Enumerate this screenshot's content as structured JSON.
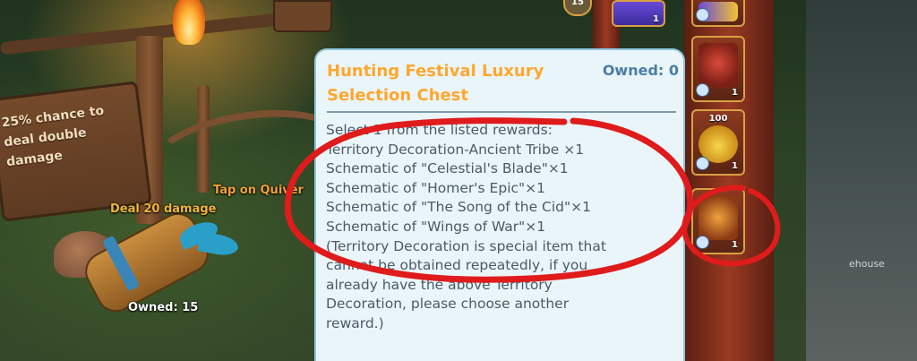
{
  "tooltip": {
    "title_line1": "Hunting Festival Luxury",
    "title_line2": "Selection Chest",
    "owned": "Owned: 0",
    "body_lines": [
      "Select 1 from the listed rewards:",
      "Territory Decoration-Ancient Tribe ×1",
      " Schematic of \"Celestial's Blade\"×1",
      " Schematic of \"Homer's Epic\"×1",
      "Schematic of \"The Song of the Cid\"×1",
      "Schematic of \"Wings of War\"×1",
      "(Territory Decoration is special item that",
      "cannot be obtained repeatedly, if you",
      "already have the above Territory",
      "Decoration, please choose another",
      "reward.)"
    ]
  },
  "game": {
    "sign_text": [
      "25% chance to",
      "deal double",
      "damage"
    ],
    "deal_damage": "Deal 20 damage",
    "tap_hint": "Tap on Quiver",
    "owned_quiver": "Owned: 15",
    "house_label": "ehouse",
    "level_badge": "15"
  },
  "right_panel": {
    "slot_counts": [
      "1",
      "1",
      "1",
      "1"
    ],
    "slot_top_number": "100",
    "mid_count": "1",
    "icons": [
      "speed-up-icon",
      "roof-decoration-icon",
      "potion-icon",
      "treasure-chest-icon"
    ]
  },
  "colors": {
    "title": "#ffa72e",
    "owned": "#4b7ea6",
    "body_text": "#4c5a66",
    "tooltip_bg": "#e9f5f9",
    "annotation": "#e01b1b"
  }
}
